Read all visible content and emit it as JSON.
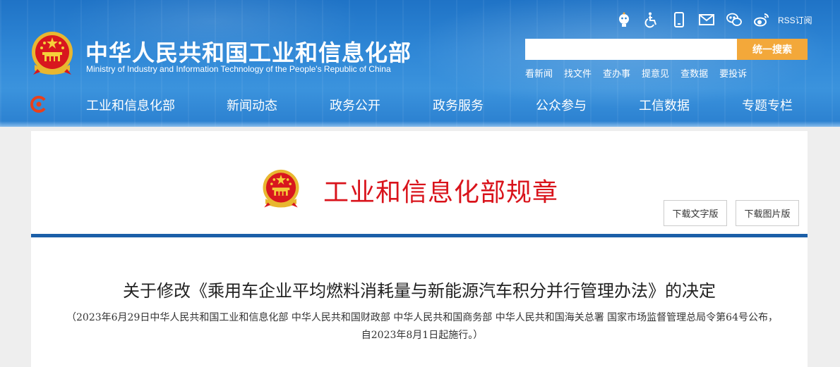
{
  "header": {
    "title": "中华人民共和国工业和信息化部",
    "subtitle": "Ministry of Industry and Information Technology of the People's Republic of China",
    "top_icons": [
      "robot-icon",
      "accessibility-icon",
      "mobile-icon",
      "mail-icon",
      "wechat-icon",
      "weibo-icon"
    ],
    "rss_label": "RSS订阅",
    "search": {
      "value": "",
      "placeholder": "",
      "button_label": "统一搜索"
    },
    "quick_links": [
      "看新闻",
      "找文件",
      "查办事",
      "提意见",
      "查数据",
      "要投诉"
    ]
  },
  "nav": {
    "items": [
      "工业和信息化部",
      "新闻动态",
      "政务公开",
      "政务服务",
      "公众参与",
      "工信数据",
      "专题专栏"
    ]
  },
  "content": {
    "section_title": "工业和信息化部规章",
    "download_text_label": "下载文字版",
    "download_image_label": "下载图片版",
    "doc_title": "关于修改《乘用车企业平均燃料消耗量与新能源汽车积分并行管理办法》的决定",
    "doc_subtitle": "（2023年6月29日中华人民共和国工业和信息化部 中华人民共和国财政部 中华人民共和国商务部 中华人民共和国海关总署 国家市场监督管理总局令第64号公布，自2023年8月1日起施行。）"
  },
  "colors": {
    "header_blue": "#2f87d6",
    "search_button": "#f3a83a",
    "section_title_red": "#d9131b",
    "divider_blue": "#1b5fa8"
  }
}
